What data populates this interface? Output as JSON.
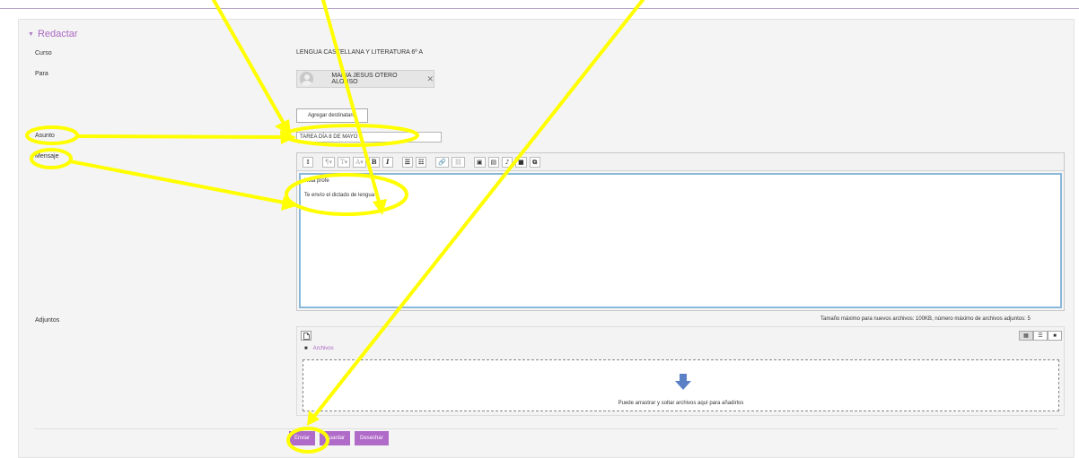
{
  "section": {
    "title": "Redactar"
  },
  "labels": {
    "course": "Curso",
    "to": "Para",
    "subject": "Asunto",
    "message": "Mensaje",
    "attachments": "Adjuntos"
  },
  "course": {
    "value": "LENGUA CASTELLANA Y LITERATURA 6º A"
  },
  "recipient": {
    "name": "MARIA JESUS OTERO ALONSO",
    "remove": "✕"
  },
  "add_recipient_label": "Agregar destinatario",
  "subject": {
    "value": "TAREA DÍA 8 DE MAYO"
  },
  "editor": {
    "toolbar": {
      "collapse": "↕",
      "paragraph": "¶▾",
      "heading": "T▾",
      "font": "A▾",
      "bold": "B",
      "italic": "I",
      "bullets": "☰",
      "numbers": "☷",
      "link": "🔗",
      "unlink": "⛓",
      "image": "▣",
      "media": "▤",
      "audio": "♪",
      "video": "■",
      "copy": "⧉"
    },
    "line1": "Hola profe",
    "line2": "Te envío el dictado de lengua"
  },
  "attachments": {
    "limits": "Tamaño máximo para nuevos archivos: 100KB, número máximo de archivos adjuntos: 5",
    "new_file_icon": "file-icon",
    "view_icons": "▦",
    "view_list": "☰",
    "view_tree": "■",
    "folder_icon": "■",
    "folder_label": "Archivos",
    "drop_text": "Puede arrastrar y soltar archivos aquí para añadirlos"
  },
  "actions": {
    "send": "Enviar",
    "save": "Guardar",
    "discard": "Desechar"
  },
  "colors": {
    "accent": "#b06bc9",
    "annotation": "#ffff00",
    "editor_focus": "#8ab8d8"
  }
}
